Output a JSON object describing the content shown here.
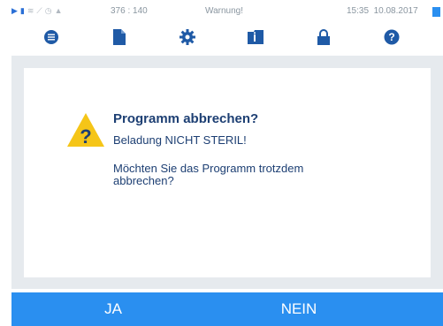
{
  "statusbar": {
    "icons": [
      "play-icon",
      "document-icon",
      "signal-icon",
      "chart-icon",
      "clock-icon",
      "lock-icon"
    ],
    "counter": "376 : 140",
    "message": "Warnung!",
    "time": "15:35",
    "date": "10.08.2017",
    "indicator_color": "#2a8ff0"
  },
  "toolbar": {
    "items": [
      {
        "icon": "list-icon"
      },
      {
        "icon": "document-icon"
      },
      {
        "icon": "gear-icon"
      },
      {
        "icon": "info-folder-icon"
      },
      {
        "icon": "lock-icon"
      },
      {
        "icon": "help-icon"
      }
    ],
    "icon_color": "#1f5aa6"
  },
  "dialog": {
    "icon": "warning-icon",
    "title": "Programm abbrechen?",
    "line1": "Beladung NICHT STERIL!",
    "line2": "Möchten Sie das Programm trotzdem abbrechen?"
  },
  "actions": {
    "yes_label": "JA",
    "no_label": "NEIN",
    "bar_color": "#2a8ff0"
  },
  "colors": {
    "text": "#1d3f73",
    "content_bg": "#e6eaee",
    "warning_yellow": "#f5c518"
  }
}
